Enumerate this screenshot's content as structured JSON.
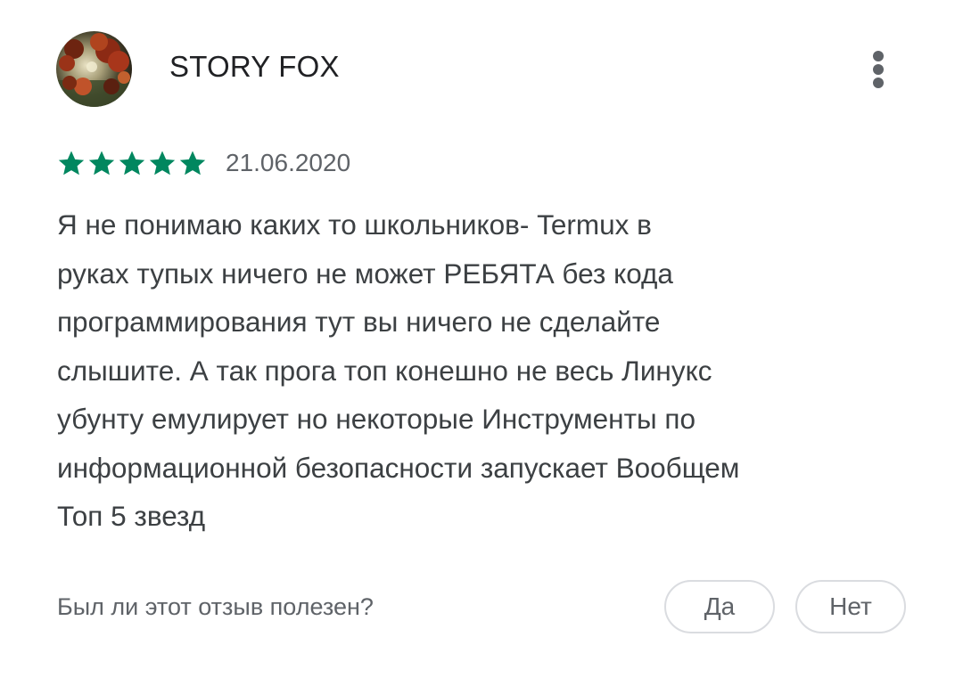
{
  "review": {
    "author": {
      "name": "STORY FOX",
      "avatar_icon": "autumn-leaves-photo"
    },
    "more_icon": "more-vertical-icon",
    "rating": {
      "value": 5,
      "max": 5,
      "star_color": "#01875f"
    },
    "date": "21.06.2020",
    "text_lines": [
      "Я не понимаю каких то школьников- Termux в",
      "руках тупых ничего не может РЕБЯТА без кода",
      "программирования тут вы ничего не сделайте",
      "слышите. А так прога топ конешно не весь Линукс",
      "убунту емулирует но некоторые Инструменты по",
      "информационной безопасности запускает Вообщем",
      "Топ 5 звезд"
    ]
  },
  "feedback": {
    "question": "Был ли этот отзыв полезен?",
    "yes_label": "Да",
    "no_label": "Нет"
  }
}
